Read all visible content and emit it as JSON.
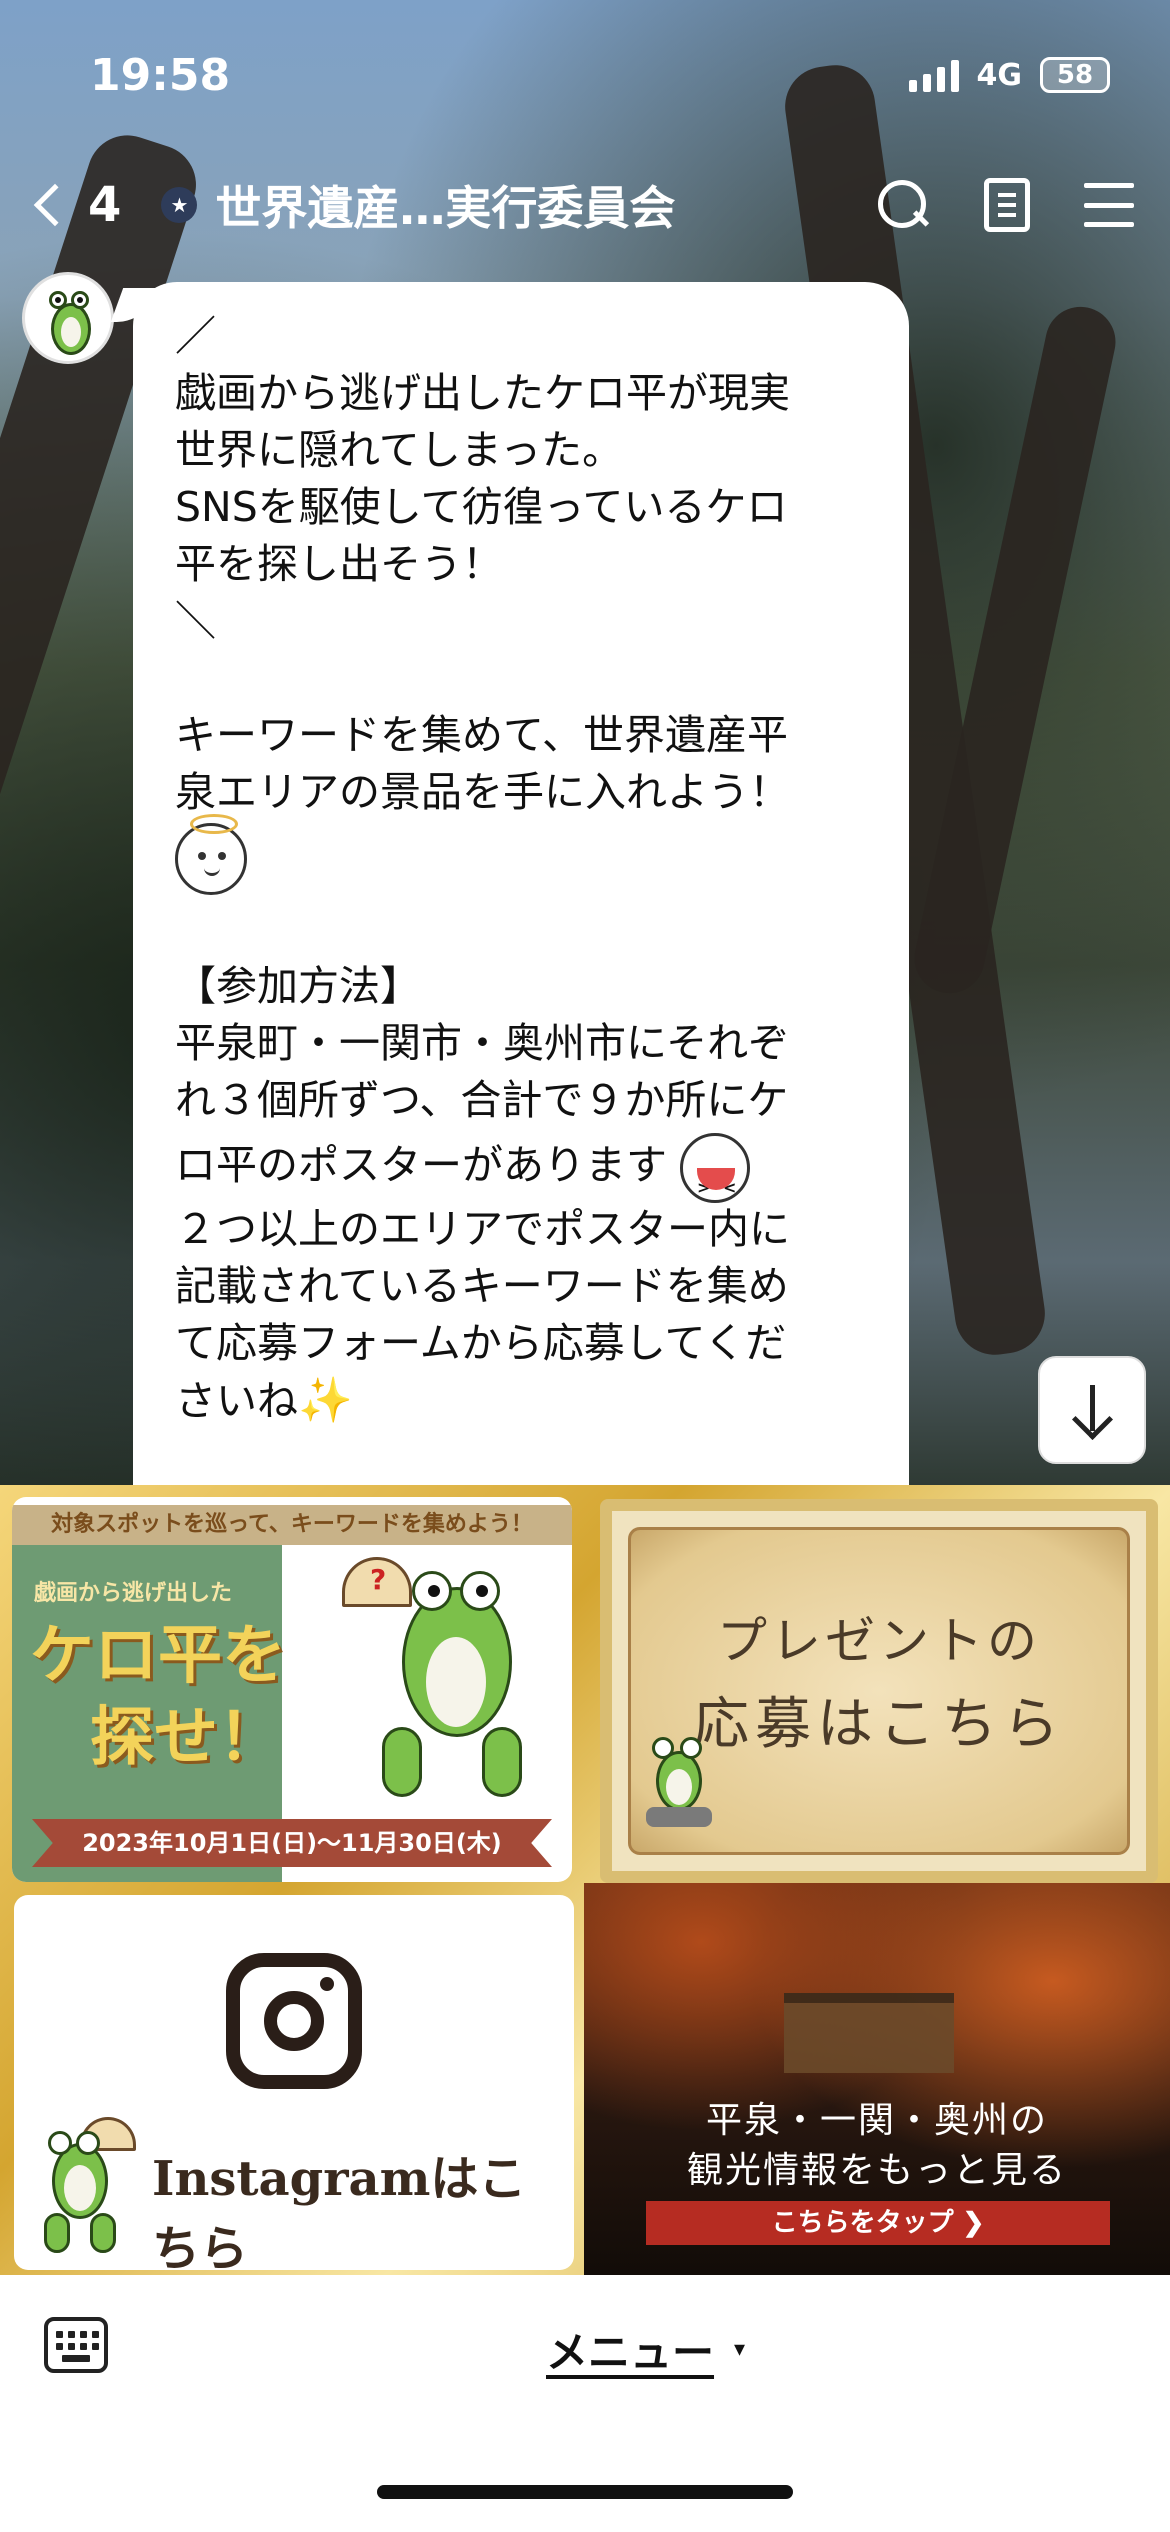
{
  "status_bar": {
    "time": "19:58",
    "network": "4G",
    "battery": "58"
  },
  "header": {
    "back_count": "4",
    "title": "世界遺産…実行委員会"
  },
  "message": {
    "lines": [
      "／",
      "戯画から逃げ出したケロ平が現実",
      "世界に隠れてしまった。",
      "SNSを駆使して彷徨っているケロ",
      "平を探し出そう！",
      "＼",
      "",
      "キーワードを集めて、世界遺産平",
      "泉エリアの景品を手に入れよう！",
      "",
      "【参加方法】",
      "平泉町・一関市・奥州市にそれぞ",
      "れ３個所ずつ、合計で９か所にケ",
      "ロ平のポスターがあります",
      "２つ以上のエリアでポスター内に",
      "記載されているキーワードを集め",
      "て応募フォームから応募してくだ",
      "さいね"
    ]
  },
  "rich_menu": {
    "tile1": {
      "banner": "対象スポットを巡って、キーワードを集めよう！",
      "small_title": "戯画から逃げ出した",
      "big_line1": "ケロ平を",
      "big_line2": "探せ！",
      "date_range": "2023年10月1日(日)〜11月30日(木)"
    },
    "tile2": {
      "line1": "プレゼントの",
      "line2": "応募はこちら"
    },
    "tile3": {
      "label": "Instagramはこちら"
    },
    "tile4": {
      "line1": "平泉・一関・奥州の",
      "line2": "観光情報をもっと見る",
      "cta": "こちらをタップ ❯"
    }
  },
  "bottom_bar": {
    "menu_label": "メニュー",
    "caret": "▾"
  },
  "icons": {
    "back": "chevron-left-icon",
    "search": "search-icon",
    "notes": "notes-icon",
    "menu": "hamburger-icon",
    "keyboard": "keyboard-icon",
    "scroll": "arrow-down-icon"
  },
  "colors": {
    "rich_menu_gold": "#d4a530",
    "cta_red": "#b62c22",
    "frog_green": "#7cc04a"
  }
}
